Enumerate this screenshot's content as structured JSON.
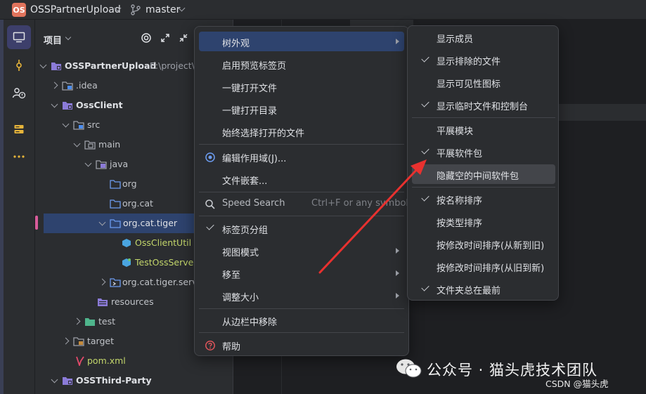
{
  "titlebar": {
    "project_badge": "OS",
    "project_name": "OSSPartnerUpload",
    "branch": "master"
  },
  "panel": {
    "title": "项目"
  },
  "tree": [
    {
      "label": "OSSPartnerUpload",
      "suffix": "E:\\project\\C",
      "bold": true
    },
    {
      "label": ".idea"
    },
    {
      "label": "OssClient",
      "bold": true
    },
    {
      "label": "src"
    },
    {
      "label": "main"
    },
    {
      "label": "java"
    },
    {
      "label": "org"
    },
    {
      "label": "org.cat"
    },
    {
      "label": "org.cat.tiger",
      "selected": true
    },
    {
      "label": "OssClientUtil",
      "green": true
    },
    {
      "label": "TestOssServerU",
      "green": true
    },
    {
      "label": "org.cat.tiger.servic"
    },
    {
      "label": "resources"
    },
    {
      "label": "test"
    },
    {
      "label": "target"
    },
    {
      "label": "pom.xml",
      "green": true
    },
    {
      "label": "OSSThird-Party",
      "bold": true
    }
  ],
  "menu": {
    "items": {
      "tree_appearance": "树外观",
      "enable_preview_tab": "启用预览标签页",
      "open_files_single_click": "一键打开文件",
      "open_dirs_single_click": "一键打开目录",
      "always_select_opened": "始终选择打开的文件",
      "edit_scopes": "编辑作用域(J)...",
      "file_nesting": "文件嵌套...",
      "speed_search": "Speed Search",
      "speed_search_shortcut": "Ctrl+F or any symbol",
      "group_tabs": "标签页分组",
      "view_mode": "视图模式",
      "move_to": "移至",
      "resize": "调整大小",
      "remove_from_sidebar": "从边栏中移除",
      "help": "帮助"
    }
  },
  "submenu": {
    "items": [
      {
        "label": "显示成员",
        "checked": false
      },
      {
        "label": "显示排除的文件",
        "checked": true
      },
      {
        "label": "显示可见性图标",
        "checked": false
      },
      {
        "label": "显示临时文件和控制台",
        "checked": true
      },
      {
        "label": "平展模块",
        "checked": false
      },
      {
        "label": "平展软件包",
        "checked": true
      },
      {
        "label": "隐藏空的中间软件包",
        "checked": false,
        "hover": true
      },
      {
        "label": "按名称排序",
        "checked": true
      },
      {
        "label": "按类型排序",
        "checked": false
      },
      {
        "label": "按修改时间排序(从新到旧)",
        "checked": false
      },
      {
        "label": "按修改时间排序(从旧到新)",
        "checked": false
      },
      {
        "label": "文件夹总在最前",
        "checked": true
      }
    ]
  },
  "watermark": {
    "text": "公众号 · 猫头虎技术团队",
    "csdn": "CSDN @猫头虎"
  },
  "colors": {
    "accent": "#3d3f6b",
    "selection": "#2e436e",
    "arrow": "#e8312f",
    "badge": "#e0735c"
  }
}
